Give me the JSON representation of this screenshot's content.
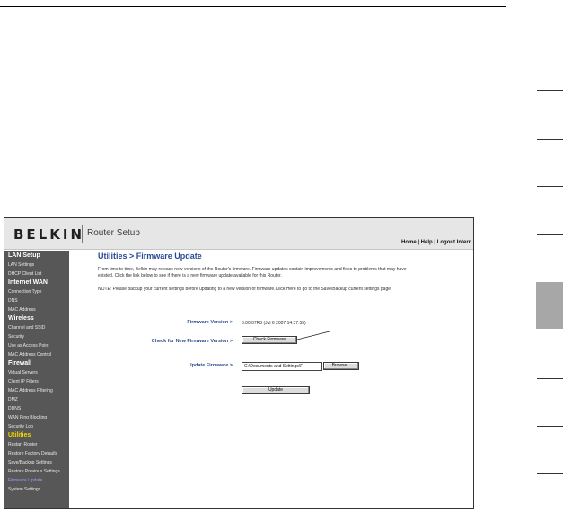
{
  "header": {
    "logo": "BELKIN",
    "title": "Router Setup",
    "links": "Home | Help | Logout   Intern"
  },
  "sidebar": [
    {
      "label": "LAN Setup",
      "type": "section"
    },
    {
      "label": "LAN Settings",
      "type": "item"
    },
    {
      "label": "DHCP Client List",
      "type": "item"
    },
    {
      "label": "Internet WAN",
      "type": "section"
    },
    {
      "label": "Connection Type",
      "type": "item"
    },
    {
      "label": "DNS",
      "type": "item"
    },
    {
      "label": "MAC Address",
      "type": "item"
    },
    {
      "label": "Wireless",
      "type": "section"
    },
    {
      "label": "Channel and SSID",
      "type": "item"
    },
    {
      "label": "Security",
      "type": "item"
    },
    {
      "label": "Use as Access Point",
      "type": "item"
    },
    {
      "label": "MAC Address Control",
      "type": "item"
    },
    {
      "label": "Firewall",
      "type": "section"
    },
    {
      "label": "Virtual Servers",
      "type": "item"
    },
    {
      "label": "Client IP Filters",
      "type": "item"
    },
    {
      "label": "MAC Address Filtering",
      "type": "item"
    },
    {
      "label": "DMZ",
      "type": "item"
    },
    {
      "label": "DDNS",
      "type": "item"
    },
    {
      "label": "WAN Ping Blocking",
      "type": "item"
    },
    {
      "label": "Security Log",
      "type": "item"
    },
    {
      "label": "Utilities",
      "type": "section-active"
    },
    {
      "label": "Restart Router",
      "type": "item"
    },
    {
      "label": "Restore Factory Defaults",
      "type": "item"
    },
    {
      "label": "Save/Backup Settings",
      "type": "item"
    },
    {
      "label": "Restore Previous Settings",
      "type": "item"
    },
    {
      "label": "Firmware Update",
      "type": "item-current"
    },
    {
      "label": "System Settings",
      "type": "item"
    }
  ],
  "main": {
    "title": "Utilities > Firmware Update",
    "intro": "From time to time, Belkin may release new versions of the Router's firmware. Firmware updates contain improvements and fixes to problems that may have existed. Click the link below to see if there is a new firmware update available for this Router.",
    "note": "NOTE: Please backup your current settings before updating to a new version of firmware.Click Here to go to the Save/Backup current settings page.",
    "firmware_version_label": "Firmware Version >",
    "firmware_version_value": "0.00.07R3 (Jul 6 2007 14:37:55)",
    "check_label": "Check for New Firmware Version >",
    "check_button": "Check Firmware",
    "update_label": "Update Firmware >",
    "file_value": "C:\\Documents and Settings\\F",
    "browse_button": "Browse...",
    "update_button": "Update"
  },
  "colors": {
    "title_blue": "#2b4a96",
    "sidebar_bg": "#575757",
    "section_active": "#f2d900",
    "current_item": "#8fa2ff"
  }
}
